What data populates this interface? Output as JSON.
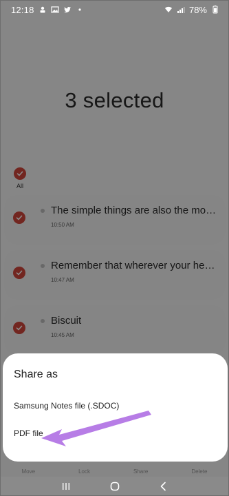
{
  "status_bar": {
    "time": "12:18",
    "battery": "78%",
    "left_icons": [
      "person-pin-icon",
      "image-icon",
      "twitter-icon",
      "dot-icon"
    ],
    "right_icons": [
      "wifi-icon",
      "signal-icon",
      "battery-icon"
    ]
  },
  "header": {
    "title": "3 selected"
  },
  "select_all": {
    "label": "All"
  },
  "notes": [
    {
      "title": "The simple things are also the most...",
      "time": "10:50 AM"
    },
    {
      "title": "Remember that wherever your hear...",
      "time": "10:47 AM"
    },
    {
      "title": "Biscuit",
      "time": "10:45 AM"
    }
  ],
  "action_bar": [
    "Move",
    "Lock",
    "Share",
    "Delete"
  ],
  "share_sheet": {
    "title": "Share as",
    "options": [
      "Samsung Notes file (.SDOC)",
      "PDF file"
    ]
  },
  "colors": {
    "checkbox": "#d0453b",
    "arrow": "#b77de6"
  },
  "nav_bar": [
    "recents-icon",
    "home-icon",
    "back-icon"
  ]
}
